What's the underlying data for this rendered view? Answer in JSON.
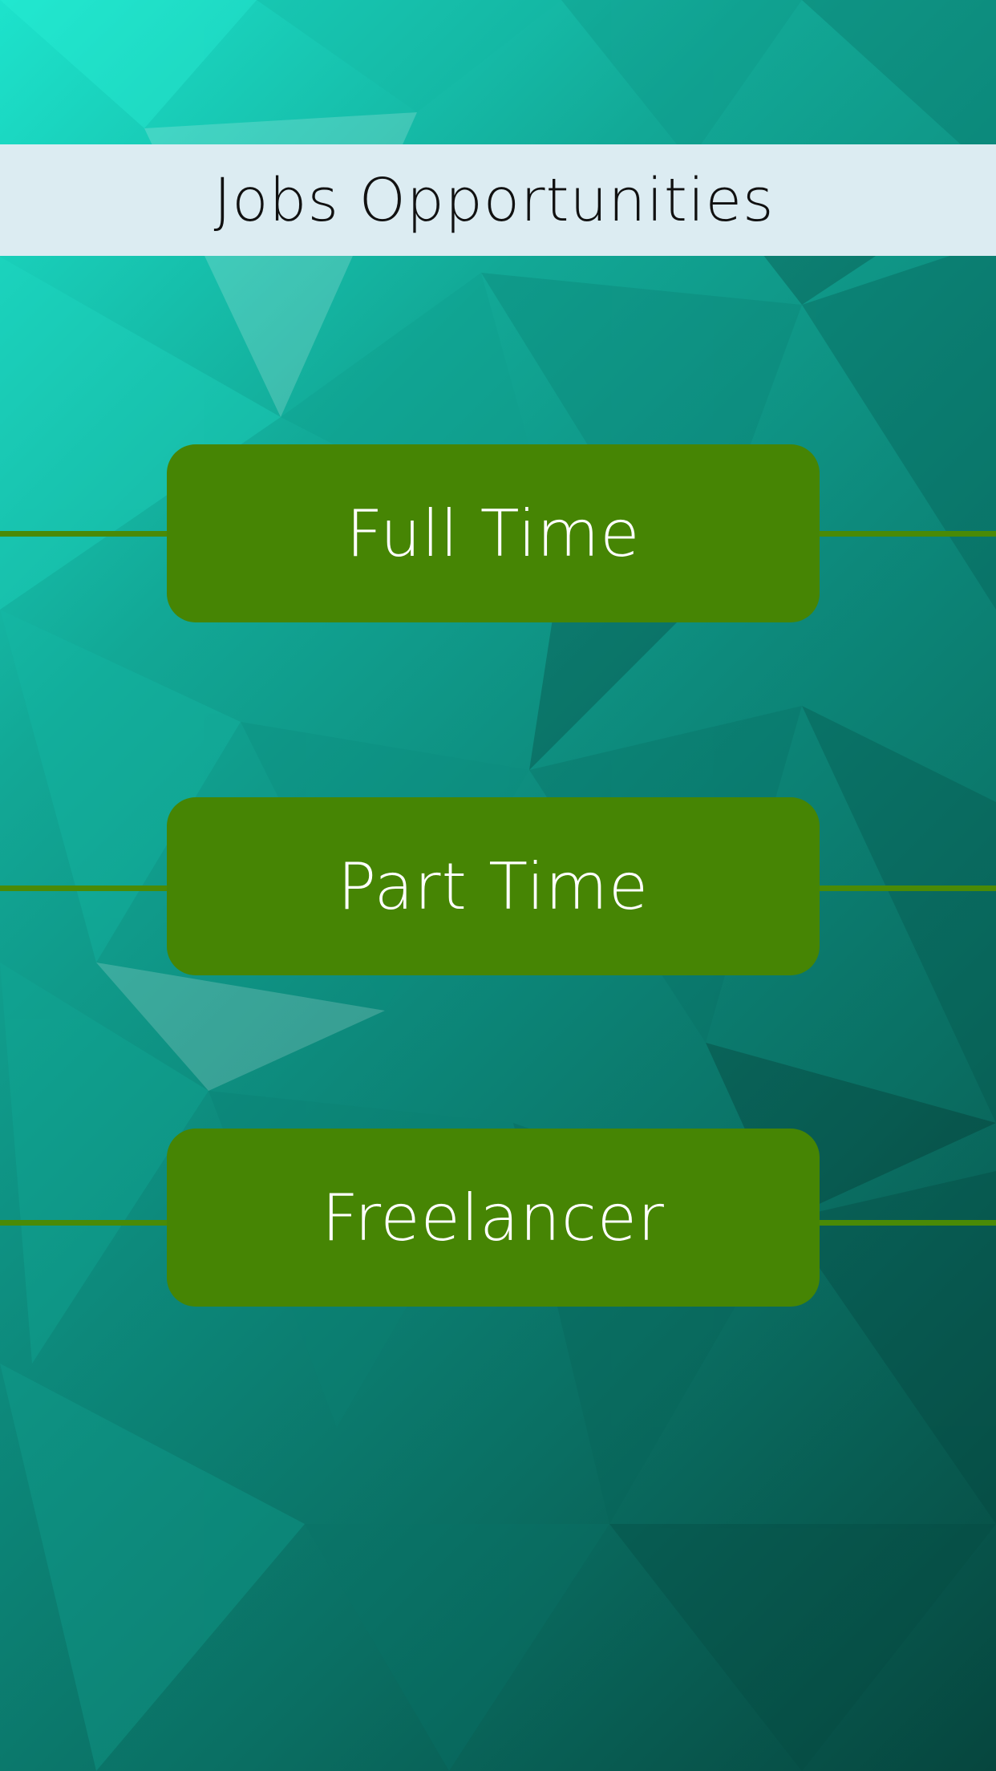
{
  "header": {
    "title": "Jobs Opportunities"
  },
  "job_types": [
    {
      "label": "Full Time"
    },
    {
      "label": "Part Time"
    },
    {
      "label": "Freelancer"
    }
  ],
  "colors": {
    "header_bg": "#dcecf2",
    "button_bg": "#468504",
    "button_text": "#ffffff",
    "connector": "#4a8a06",
    "background_light": "#1de3cc",
    "background_dark": "#06463e"
  }
}
